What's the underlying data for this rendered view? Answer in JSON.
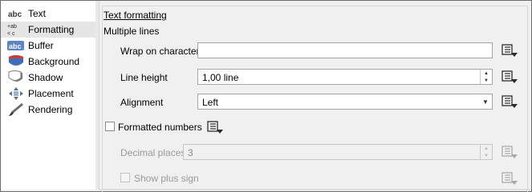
{
  "sidebar": {
    "items": [
      {
        "label": "Text",
        "icon": "abc-text-icon"
      },
      {
        "label": "Formatting",
        "icon": "formatting-icon"
      },
      {
        "label": "Buffer",
        "icon": "buffer-icon"
      },
      {
        "label": "Background",
        "icon": "background-shield-icon"
      },
      {
        "label": "Shadow",
        "icon": "shadow-icon"
      },
      {
        "label": "Placement",
        "icon": "placement-icon"
      },
      {
        "label": "Rendering",
        "icon": "rendering-brush-icon"
      }
    ],
    "selected_index": 1
  },
  "main": {
    "section_title": "Text formatting",
    "multiple_lines_header": "Multiple lines",
    "wrap_on_character": {
      "label": "Wrap on character",
      "value": ""
    },
    "line_height": {
      "label": "Line height",
      "value": "1,00 line"
    },
    "alignment": {
      "label": "Alignment",
      "value": "Left"
    },
    "formatted_numbers": {
      "label": "Formatted numbers",
      "checked": false
    },
    "decimal_places": {
      "label": "Decimal places",
      "value": "3",
      "enabled": false
    },
    "show_plus_sign": {
      "label": "Show plus sign",
      "checked": false,
      "enabled": false
    }
  },
  "icons": {
    "data_defined_override": "data-defined-override-icon",
    "spin_up": "up-arrow",
    "spin_down": "down-arrow",
    "combo_arrow": "chevron-down-icon"
  },
  "colors": {
    "selected_row": "#e5e5e5",
    "background": "#f0f0f0",
    "icon_blue": "#3e6fb8",
    "icon_red": "#d23b2f"
  }
}
